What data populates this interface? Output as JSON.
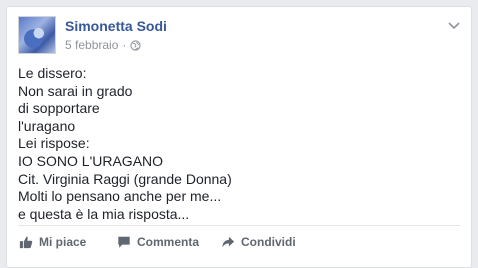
{
  "post": {
    "author": "Simonetta Sodi",
    "date": "5 febbraio",
    "separator": "·",
    "privacy_icon": "globe-icon",
    "lines": [
      "Le dissero:",
      "Non sarai in grado",
      "di sopportare",
      "l'uragano",
      "Lei rispose:",
      "IO SONO L'URAGANO",
      "Cit. Virginia Raggi (grande Donna)",
      "Molti lo pensano anche per me...",
      "e questa è la mia risposta..."
    ]
  },
  "actions": {
    "like_label": "Mi piace",
    "comment_label": "Commenta",
    "share_label": "Condividi"
  },
  "colors": {
    "author_link": "#365899",
    "meta_text": "#90949c",
    "body_text": "#1d2129",
    "action_text": "#606770",
    "page_background": "#e9ebee"
  }
}
